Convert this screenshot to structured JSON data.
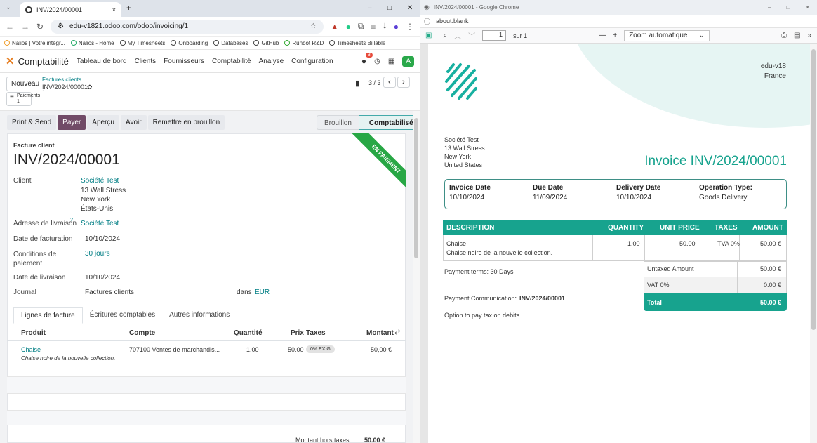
{
  "left_window": {
    "tab": {
      "title": "INV/2024/00001",
      "close": "×",
      "new_tab": "+"
    },
    "window_controls": {
      "min": "–",
      "max": "□",
      "close": "✕"
    },
    "url": "edu-v1821.odoo.com/odoo/invoicing/1",
    "bookmarks": [
      "Nalios | Votre intégr...",
      "Nalios - Home",
      "My Timesheets",
      "Onboarding",
      "Databases",
      "GitHub",
      "Runbot R&D",
      "Timesheets Billable"
    ],
    "menu": {
      "app": "Comptabilité",
      "items": [
        "Tableau de bord",
        "Clients",
        "Fournisseurs",
        "Comptabilité",
        "Analyse",
        "Configuration"
      ],
      "badge": "3",
      "avatar": "A"
    },
    "control": {
      "new": "Nouveau",
      "breadcrumb_parent": "Factures clients",
      "breadcrumb_current": "INV/2024/00001",
      "pager": "3 / 3",
      "payments_label": "Paiements",
      "payments_count": "1"
    },
    "actions": [
      "Print & Send",
      "Payer",
      "Aperçu",
      "Avoir",
      "Remettre en brouillon"
    ],
    "status": {
      "draft": "Brouillon",
      "posted": "Comptabilisé"
    },
    "ribbon": "EN PAIEMENT",
    "form": {
      "type": "Facture client",
      "name": "INV/2024/00001",
      "client_label": "Client",
      "client": "Société Test",
      "addr1": "13 Wall Stress",
      "addr2": "New York",
      "addr3": "États-Unis",
      "delivery_addr_label": "Adresse de livraison",
      "delivery_addr_help": "?",
      "delivery_addr": "Société Test",
      "invoice_date_label": "Date de facturation",
      "invoice_date": "10/10/2024",
      "terms_label": "Conditions de paiement",
      "terms": "30 jours",
      "delivery_date_label": "Date de livraison",
      "delivery_date": "10/10/2024",
      "journal_label": "Journal",
      "journal": "Factures clients",
      "in_label": "dans",
      "currency": "EUR"
    },
    "tabs": [
      "Lignes de facture",
      "Écritures comptables",
      "Autres informations"
    ],
    "table": {
      "headers": {
        "product": "Produit",
        "account": "Compte",
        "qty": "Quantité",
        "price": "Prix",
        "taxes": "Taxes",
        "amount": "Montant"
      },
      "row": {
        "product": "Chaise",
        "desc": "Chaise noire de la nouvelle collection.",
        "account": "707100 Ventes de marchandis...",
        "qty": "1.00",
        "price": "50.00",
        "tax": "0% EX G",
        "amount": "50,00 €"
      }
    },
    "totals": {
      "untaxed_label": "Montant hors taxes:",
      "untaxed": "50.00 €"
    }
  },
  "right_window": {
    "title": "INV/2024/00001 - Google Chrome",
    "address": "about:blank",
    "pdf": {
      "page_input": "1",
      "page_of": "sur 1",
      "zoom": "Zoom automatique",
      "minus": "—",
      "plus": "+"
    },
    "invoice": {
      "company": "edu-v18",
      "company_country": "France",
      "partner": [
        "Société Test",
        "13 Wall Stress",
        "New York",
        "United States"
      ],
      "title": "Invoice INV/2024/00001",
      "info": [
        {
          "label": "Invoice Date",
          "value": "10/10/2024"
        },
        {
          "label": "Due Date",
          "value": "11/09/2024"
        },
        {
          "label": "Delivery Date",
          "value": "10/10/2024"
        },
        {
          "label": "Operation Type:",
          "value": "Goods Delivery"
        }
      ],
      "headers": {
        "desc": "DESCRIPTION",
        "qty": "QUANTITY",
        "price": "UNIT PRICE",
        "taxes": "TAXES",
        "amount": "AMOUNT"
      },
      "line": {
        "name": "Chaise",
        "desc": "Chaise noire de la nouvelle collection.",
        "qty": "1.00",
        "price": "50.00",
        "tax": "TVA 0%",
        "amount": "50.00 €"
      },
      "payment_terms": "Payment terms: 30 Days",
      "untaxed_label": "Untaxed Amount",
      "untaxed": "50.00 €",
      "vat_label": "VAT 0%",
      "vat": "0.00 €",
      "total_label": "Total",
      "total": "50.00 €",
      "comm_label": "Payment Communication:",
      "comm": "INV/2024/00001",
      "tax_note": "Option to pay tax on debits"
    }
  },
  "colors": {
    "odoo_purple": "#714b67",
    "teal": "#17a38e",
    "ribbon": "#28a745",
    "link": "#017e84"
  }
}
